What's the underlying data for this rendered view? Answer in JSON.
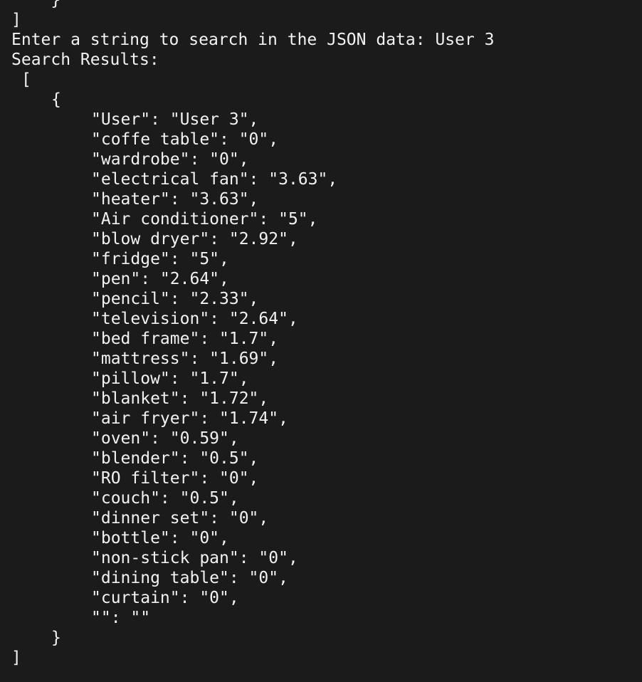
{
  "terminal": {
    "pre_lines": [
      {
        "text": "    }"
      },
      {
        "text": "]"
      }
    ],
    "prompt": {
      "label": "Enter a string to search in the JSON data: ",
      "value": "User 3"
    },
    "results_header": "Search Results:",
    "open_bracket": "[",
    "open_brace": "{",
    "entries": [
      "\"User\": \"User 3\",",
      "\"coffe table\": \"0\",",
      "\"wardrobe\": \"0\",",
      "\"electrical fan\": \"3.63\",",
      "\"heater\": \"3.63\",",
      "\"Air conditioner\": \"5\",",
      "\"blow dryer\": \"2.92\",",
      "\"fridge\": \"5\",",
      "\"pen\": \"2.64\",",
      "\"pencil\": \"2.33\",",
      "\"television\": \"2.64\",",
      "\"bed frame\": \"1.7\",",
      "\"mattress\": \"1.69\",",
      "\"pillow\": \"1.7\",",
      "\"blanket\": \"1.72\",",
      "\"air fryer\": \"1.74\",",
      "\"oven\": \"0.59\",",
      "\"blender\": \"0.5\",",
      "\"RO filter\": \"0\",",
      "\"couch\": \"0.5\",",
      "\"dinner set\": \"0\",",
      "\"bottle\": \"0\",",
      "\"non-stick pan\": \"0\",",
      "\"dining table\": \"0\",",
      "\"curtain\": \"0\",",
      "\"\": \"\""
    ],
    "close_brace": "}",
    "close_bracket": "]"
  }
}
